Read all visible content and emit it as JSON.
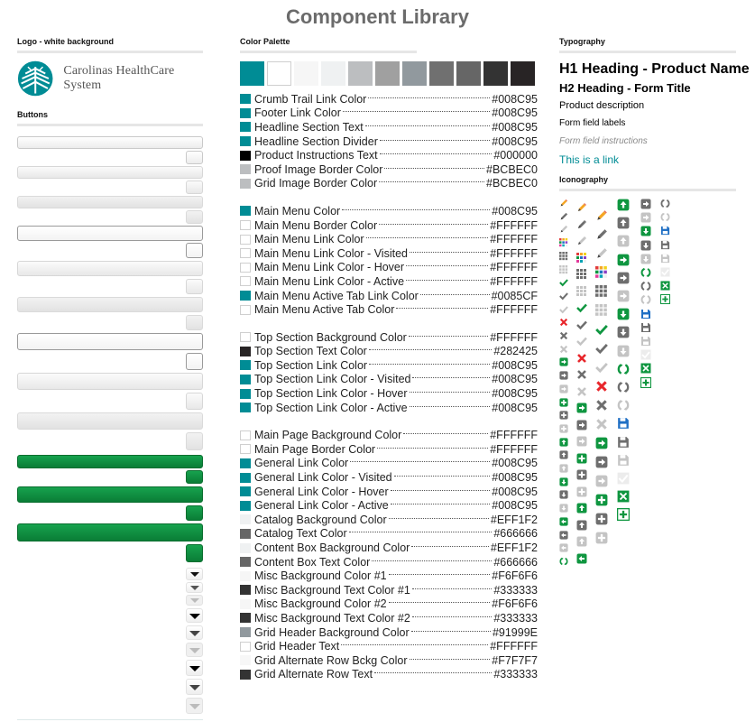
{
  "page": {
    "title": "Component Library"
  },
  "logo_section": {
    "heading": "Logo - white background",
    "logo_text": "Carolinas HealthCare System",
    "brand_color": "#008C95"
  },
  "buttons_section": {
    "heading": "Buttons",
    "gray_buttons": [
      "default",
      "hover",
      "pressed",
      "focused",
      "light",
      "flat",
      "outlined",
      "light-2",
      "pressed-2"
    ],
    "green_buttons": [
      "primary",
      "primary-hover",
      "primary-pressed"
    ],
    "green_color": "#0F8C3F",
    "dropdown_arrows": [
      {
        "size": "small",
        "shade": "dark"
      },
      {
        "size": "small",
        "shade": "medium"
      },
      {
        "size": "small",
        "shade": "light"
      },
      {
        "size": "medium",
        "shade": "dark"
      },
      {
        "size": "medium",
        "shade": "medium"
      },
      {
        "size": "medium",
        "shade": "light"
      },
      {
        "size": "large",
        "shade": "dark"
      },
      {
        "size": "large",
        "shade": "medium"
      },
      {
        "size": "large",
        "shade": "light"
      }
    ]
  },
  "palette_section": {
    "heading": "Color Palette",
    "swatches": [
      "#008C95",
      "#FFFFFF",
      "#F6F6F6",
      "#EFF1F2",
      "#BCBEC0",
      "#A0A0A0",
      "#91999E",
      "#707070",
      "#666666",
      "#333333",
      "#282425"
    ],
    "groups": [
      [
        {
          "name": "Crumb Trail Link Color",
          "hex": "#008C95"
        },
        {
          "name": "Footer Link Color",
          "hex": "#008C95"
        },
        {
          "name": "Headline Section Text",
          "hex": "#008C95"
        },
        {
          "name": "Headline Section Divider",
          "hex": "#008C95"
        },
        {
          "name": "Product Instructions Text",
          "hex": "#000000"
        },
        {
          "name": "Proof Image Border Color",
          "hex": "#BCBEC0"
        },
        {
          "name": "Grid Image Border Color",
          "hex": "#BCBEC0"
        }
      ],
      [
        {
          "name": "Main Menu Color",
          "hex": "#008C95"
        },
        {
          "name": "Main Menu Border Color",
          "hex": "#FFFFFF"
        },
        {
          "name": "Main Menu Link Color",
          "hex": "#FFFFFF"
        },
        {
          "name": "Main Menu Link Color - Visited",
          "hex": "#FFFFFF"
        },
        {
          "name": "Main Menu Link Color - Hover",
          "hex": "#FFFFFF"
        },
        {
          "name": "Main Menu Link Color - Active",
          "hex": "#FFFFFF"
        },
        {
          "name": "Main Menu Active Tab Link Color",
          "hex": "#0085CF",
          "chip": "#008C95"
        },
        {
          "name": "Main Menu Active Tab Color",
          "hex": "#FFFFFF"
        }
      ],
      [
        {
          "name": "Top Section Background Color",
          "hex": "#FFFFFF"
        },
        {
          "name": "Top Section Text Color",
          "hex": "#282425"
        },
        {
          "name": "Top Section Link Color",
          "hex": "#008C95"
        },
        {
          "name": "Top Section Link Color - Visited",
          "hex": "#008C95"
        },
        {
          "name": "Top Section Link Color - Hover",
          "hex": "#008C95"
        },
        {
          "name": "Top Section Link Color - Active",
          "hex": "#008C95"
        }
      ],
      [
        {
          "name": "Main Page Background Color",
          "hex": "#FFFFFF"
        },
        {
          "name": "Main Page Border Color",
          "hex": "#FFFFFF"
        },
        {
          "name": "General Link Color",
          "hex": "#008C95"
        },
        {
          "name": "General Link Color - Visited",
          "hex": "#008C95"
        },
        {
          "name": "General Link Color - Hover",
          "hex": "#008C95"
        },
        {
          "name": "General Link Color - Active",
          "hex": "#008C95"
        },
        {
          "name": "Catalog Background Color",
          "hex": "#EFF1F2"
        },
        {
          "name": "Catalog Text Color",
          "hex": "#666666"
        },
        {
          "name": "Content Box Background Color",
          "hex": "#EFF1F2"
        },
        {
          "name": "Content Box Text Color",
          "hex": "#666666"
        },
        {
          "name": "Misc Background Color #1",
          "hex": "#F6F6F6"
        },
        {
          "name": "Misc Background Text Color #1",
          "hex": "#333333"
        },
        {
          "name": "Misc Background Color #2",
          "hex": "#F6F6F6"
        },
        {
          "name": "Misc Background Text Color #2",
          "hex": "#333333"
        },
        {
          "name": "Grid Header Background Color",
          "hex": "#91999E"
        },
        {
          "name": "Grid Header Text",
          "hex": "#FFFFFF"
        },
        {
          "name": "Grid Alternate Row Bckg Color",
          "hex": "#F7F7F7"
        },
        {
          "name": "Grid Alternate Row Text",
          "hex": "#333333"
        }
      ]
    ]
  },
  "typography_section": {
    "heading": "Typography",
    "h1": "H1 Heading - Product Name",
    "h2": "H2 Heading - Form Title",
    "description": "Product description",
    "field_label": "Form field labels",
    "field_instructions": "Form field instructions",
    "link": "This is a link",
    "link_color": "#008C95"
  },
  "iconography_section": {
    "heading": "Iconography",
    "states": {
      "green": "#0F9640",
      "orange": "#F5A623",
      "dark": "#6E6E6E",
      "light": "#C4C4C4",
      "red": "#E8262B",
      "blue": "#1F6FC4"
    },
    "columns": [
      [
        "pencil-orange",
        "pencil-dark",
        "pencil-light",
        "palette-color",
        "palette-dark",
        "palette-light",
        "check-green",
        "check-dark",
        "check-light",
        "x-red",
        "x-dark",
        "x-light",
        "arrow-right-green",
        "arrow-right-dark",
        "arrow-right-light",
        "plus-green",
        "plus-dark",
        "plus-light",
        "arrow-up-green",
        "arrow-up-dark",
        "arrow-up-light",
        "arrow-down-green",
        "arrow-down-dark",
        "arrow-down-light",
        "arrow-left-green",
        "arrow-left-dark",
        "arrow-left-light",
        "refresh-green"
      ],
      [
        "pencil-orange",
        "pencil-dark",
        "pencil-light",
        "palette-color",
        "palette-dark",
        "palette-light",
        "check-green",
        "check-dark",
        "check-light",
        "x-red",
        "x-dark",
        "x-light",
        "arrow-right-green",
        "arrow-right-dark",
        "arrow-right-light",
        "plus-green",
        "plus-dark",
        "plus-light",
        "arrow-up-green",
        "arrow-up-dark",
        "arrow-up-light",
        "arrow-left-green"
      ],
      [
        "pencil-orange",
        "pencil-dark",
        "pencil-light",
        "palette-color",
        "palette-dark",
        "palette-light",
        "check-green",
        "check-dark",
        "check-light",
        "x-red",
        "x-dark",
        "x-light",
        "arrow-right-green",
        "arrow-right-dark",
        "arrow-right-light",
        "plus-green",
        "plus-dark",
        "plus-light"
      ],
      [
        "arrow-up-green",
        "arrow-up-dark",
        "arrow-up-light",
        "arrow-right-green",
        "arrow-right-dark",
        "arrow-right-light",
        "arrow-down-green",
        "arrow-down-dark",
        "arrow-down-light",
        "refresh-green",
        "refresh-dark",
        "refresh-light",
        "save-blue",
        "save-dark",
        "save-light",
        "check-box-light",
        "swap-green",
        "add-box-green"
      ],
      [
        "arrow-right-dark",
        "arrow-right-light",
        "arrow-down-green",
        "arrow-down-dark",
        "arrow-down-light",
        "refresh-green",
        "refresh-dark",
        "refresh-light",
        "save-blue",
        "save-dark",
        "save-light",
        "check-box-light",
        "swap-green",
        "add-box-green"
      ],
      [
        "refresh-dark",
        "refresh-light",
        "save-blue",
        "save-dark",
        "save-light",
        "check-box-light",
        "swap-green",
        "add-box-green"
      ]
    ]
  }
}
